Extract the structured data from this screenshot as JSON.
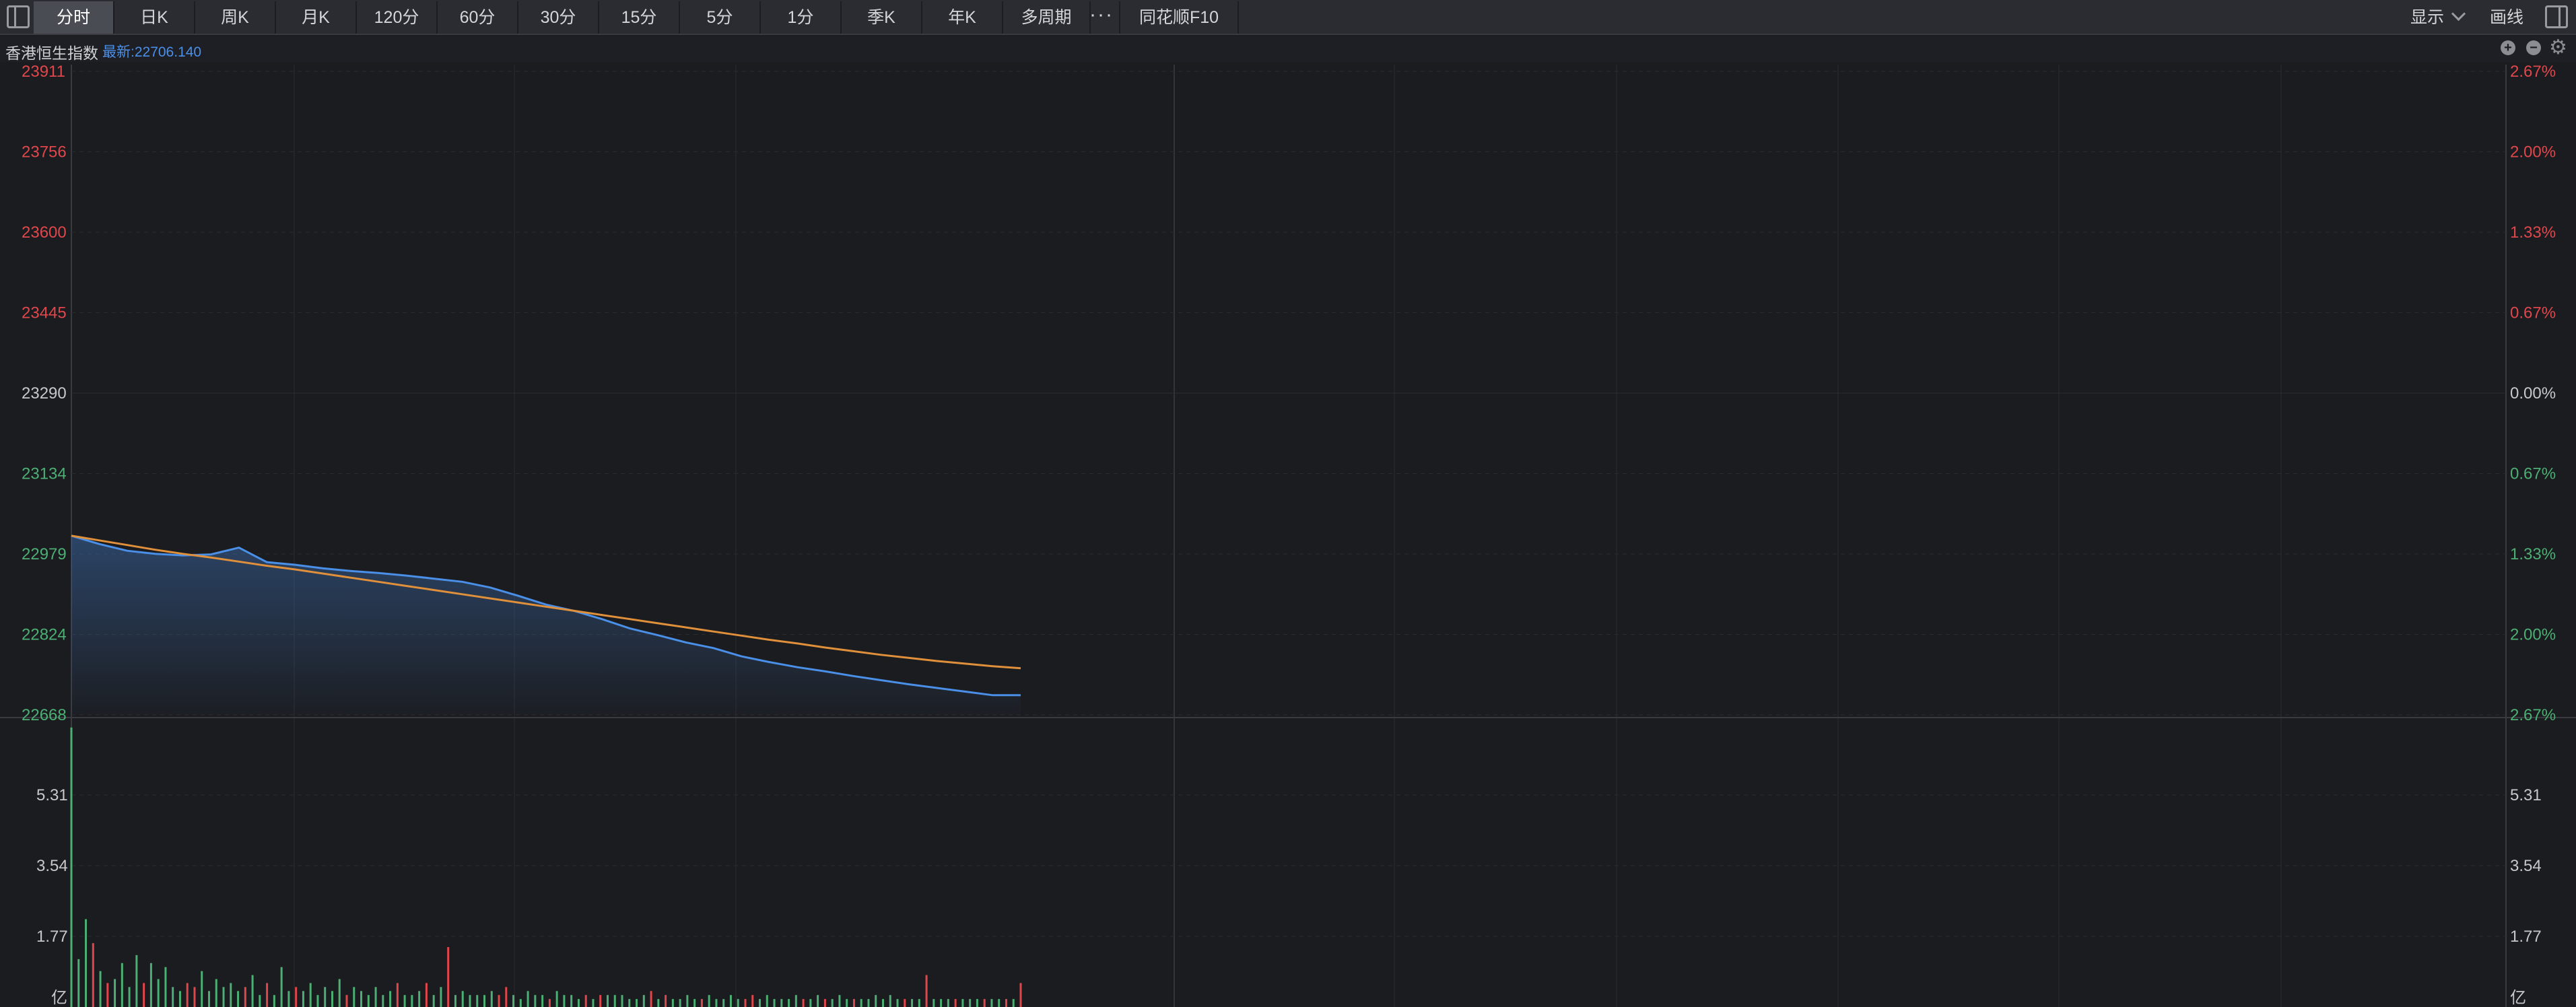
{
  "toolbar": {
    "tabs": [
      {
        "label": "分时",
        "active": true
      },
      {
        "label": "日K",
        "active": false
      },
      {
        "label": "周K",
        "active": false
      },
      {
        "label": "月K",
        "active": false
      },
      {
        "label": "120分",
        "active": false
      },
      {
        "label": "60分",
        "active": false
      },
      {
        "label": "30分",
        "active": false
      },
      {
        "label": "15分",
        "active": false
      },
      {
        "label": "5分",
        "active": false
      },
      {
        "label": "1分",
        "active": false
      },
      {
        "label": "季K",
        "active": false
      },
      {
        "label": "年K",
        "active": false
      },
      {
        "label": "多周期",
        "active": false
      }
    ],
    "more_label": "···",
    "f10_label": "同花顺F10",
    "display_label": "显示",
    "draw_label": "画线"
  },
  "info": {
    "index_name": "香港恒生指数",
    "latest": "最新:22706.140"
  },
  "colors": {
    "up": "#e0474c",
    "down": "#4caf73",
    "neutral": "#c8c8cc",
    "price_line": "#4a8fe8",
    "avg_line": "#e0903a",
    "grid": "#2a2b30"
  },
  "chart_data": {
    "type": "line",
    "price_axis": {
      "ticks": [
        "23911",
        "23756",
        "23600",
        "23445",
        "23290",
        "23134",
        "22979",
        "22824",
        "22668"
      ],
      "range": [
        22668,
        23911
      ],
      "base": 23290
    },
    "percent_axis": {
      "ticks": [
        "2.67%",
        "2.00%",
        "1.33%",
        "0.67%",
        "0.00%",
        "0.67%",
        "1.33%",
        "2.00%",
        "2.67%"
      ]
    },
    "volume_axis": {
      "ticks": [
        "5.31",
        "3.54",
        "1.77"
      ],
      "unit": "亿",
      "max": 7.08
    },
    "series": [
      {
        "values": [
          23014,
          22998,
          22985,
          22979,
          22976,
          22978,
          22991,
          22963,
          22958,
          22951,
          22946,
          22942,
          22937,
          22931,
          22925,
          22914,
          22898,
          22881,
          22869,
          22853,
          22835,
          22822,
          22808,
          22797,
          22781,
          22770,
          22760,
          22752,
          22743,
          22735,
          22727,
          22720,
          22713,
          22706,
          22706
        ]
      },
      {
        "values": [
          23014,
          23005,
          22996,
          22987,
          22979,
          22972,
          22964,
          22956,
          22949,
          22941,
          22933,
          22925,
          22917,
          22909,
          22901,
          22893,
          22885,
          22877,
          22869,
          22861,
          22853,
          22845,
          22837,
          22829,
          22821,
          22813,
          22806,
          22798,
          22791,
          22784,
          22778,
          22772,
          22767,
          22762,
          22758
        ]
      }
    ],
    "volume": [
      7.0,
      1.2,
      2.2,
      1.6,
      0.9,
      0.6,
      0.7,
      1.1,
      0.5,
      1.3,
      0.6,
      1.1,
      0.7,
      1.0,
      0.5,
      0.4,
      0.6,
      0.5,
      0.9,
      0.4,
      0.7,
      0.5,
      0.6,
      0.4,
      0.5,
      0.8,
      0.3,
      0.6,
      0.3,
      1.0,
      0.4,
      0.5,
      0.4,
      0.6,
      0.3,
      0.5,
      0.4,
      0.7,
      0.3,
      0.5,
      0.4,
      0.3,
      0.5,
      0.3,
      0.4,
      0.6,
      0.3,
      0.3,
      0.4,
      0.6,
      0.3,
      0.5,
      1.5,
      0.3,
      0.4,
      0.3,
      0.3,
      0.3,
      0.4,
      0.3,
      0.5,
      0.3,
      0.2,
      0.4,
      0.3,
      0.3,
      0.2,
      0.4,
      0.3,
      0.3,
      0.2,
      0.3,
      0.2,
      0.3,
      0.3,
      0.3,
      0.3,
      0.2,
      0.2,
      0.3,
      0.4,
      0.2,
      0.3,
      0.2,
      0.2,
      0.3,
      0.2,
      0.2,
      0.3,
      0.2,
      0.2,
      0.3,
      0.2,
      0.2,
      0.3,
      0.2,
      0.3,
      0.2,
      0.2,
      0.2,
      0.3,
      0.2,
      0.2,
      0.3,
      0.2,
      0.2,
      0.3,
      0.2,
      0.2,
      0.2,
      0.2,
      0.3,
      0.2,
      0.3,
      0.2,
      0.2,
      0.2,
      0.2,
      0.8,
      0.2,
      0.2,
      0.2,
      0.2,
      0.2,
      0.2,
      0.2,
      0.2,
      0.2,
      0.2,
      0.2,
      0.2,
      0.6
    ]
  }
}
